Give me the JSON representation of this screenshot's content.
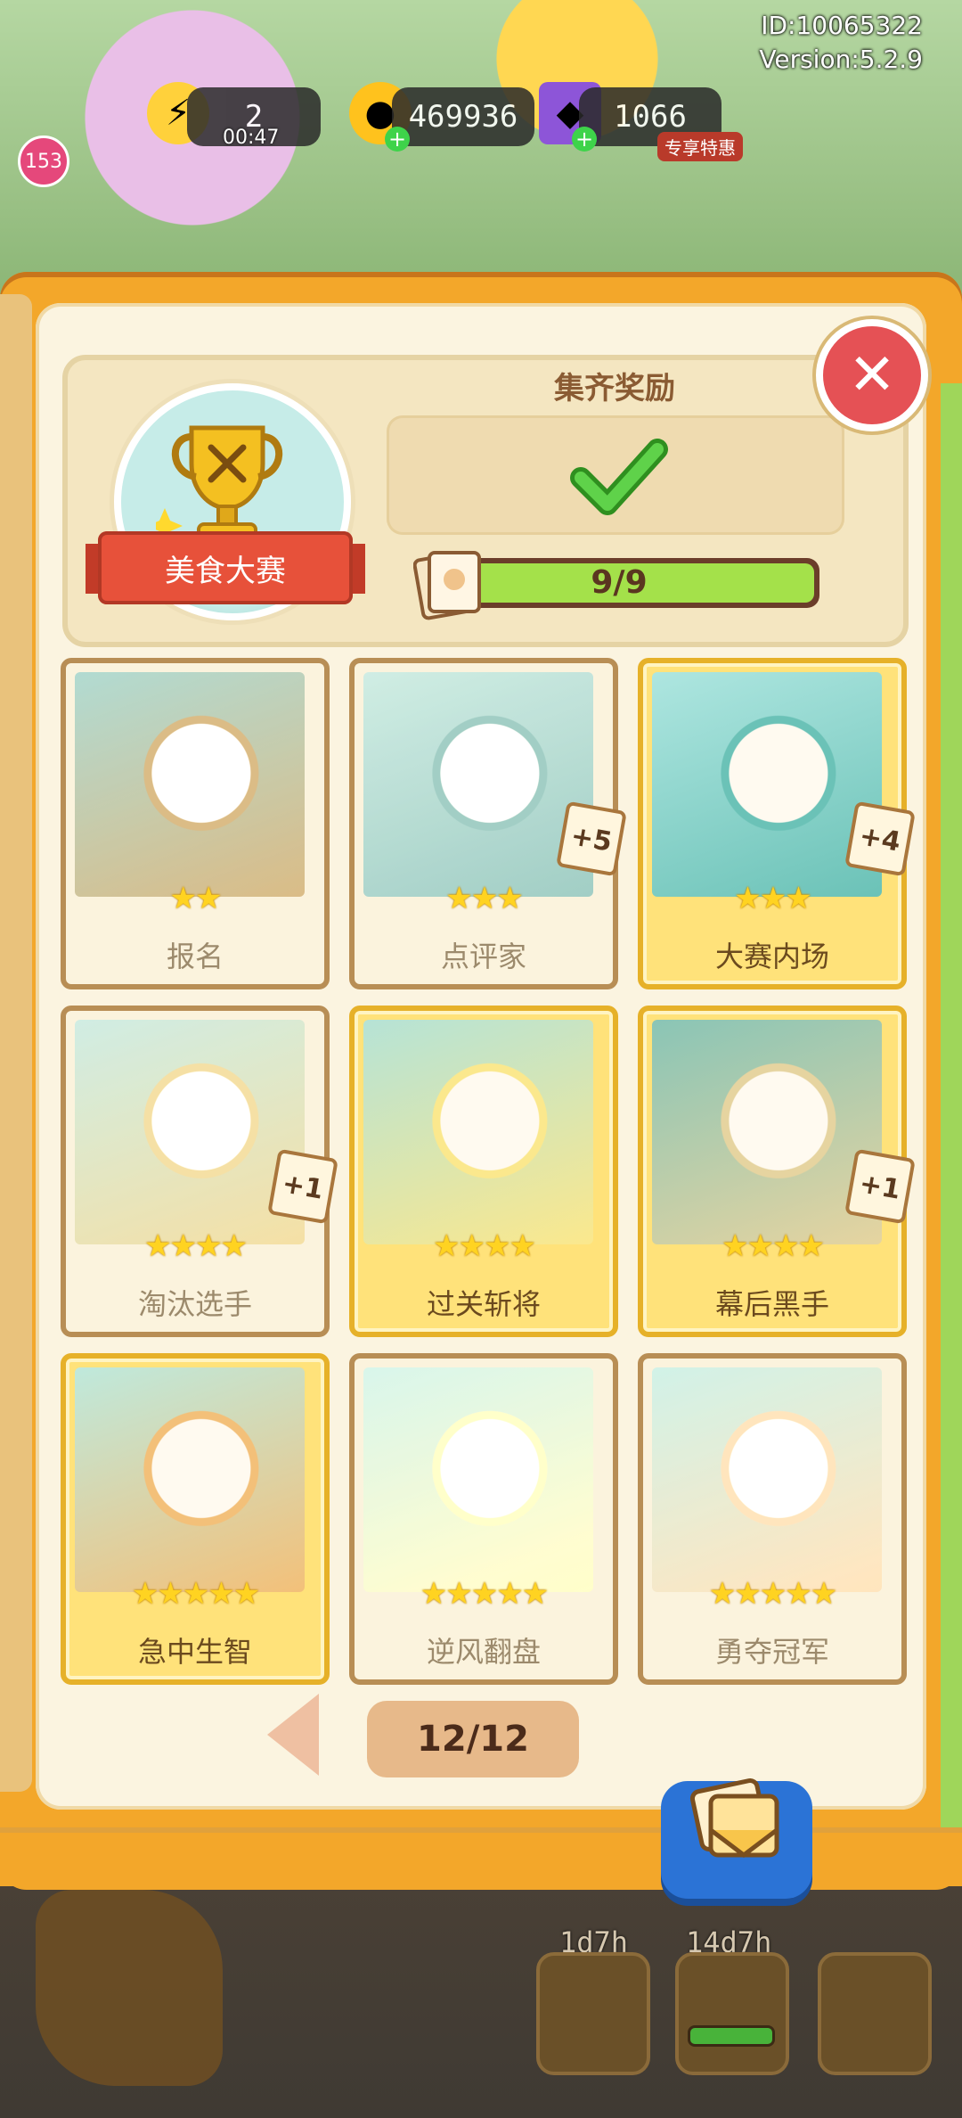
{
  "status": {
    "id_text": "ID:10065322",
    "version_text": "Version:5.2.9",
    "badge": "153"
  },
  "resources": {
    "energy": {
      "value": "2",
      "timer": "00:47"
    },
    "coins": {
      "value": "469936"
    },
    "gems": {
      "value": "1066",
      "tag": "专享特惠"
    }
  },
  "album": {
    "name": "美食大赛",
    "reward_title": "集齐奖励",
    "progress_text": "9/9",
    "progress_fraction": 1.0
  },
  "cards": [
    {
      "name": "报名",
      "stars": 2,
      "style": "plain",
      "extra": ""
    },
    {
      "name": "点评家",
      "stars": 3,
      "style": "plain",
      "extra": "+5"
    },
    {
      "name": "大赛内场",
      "stars": 3,
      "style": "gold",
      "extra": "+4"
    },
    {
      "name": "淘汰选手",
      "stars": 4,
      "style": "plain",
      "extra": "+1"
    },
    {
      "name": "过关斩将",
      "stars": 4,
      "style": "gold",
      "extra": ""
    },
    {
      "name": "幕后黑手",
      "stars": 4,
      "style": "gold",
      "extra": "+1"
    },
    {
      "name": "急中生智",
      "stars": 5,
      "style": "gold",
      "extra": ""
    },
    {
      "name": "逆风翻盘",
      "stars": 5,
      "style": "plain",
      "extra": ""
    },
    {
      "name": "勇夺冠军",
      "stars": 5,
      "style": "plain",
      "extra": ""
    }
  ],
  "pagination": {
    "page_text": "12/12"
  },
  "hud": {
    "timer_a": "1d7h",
    "timer_b": "14d7h"
  },
  "icons": {
    "close": "close-icon",
    "check": "check-icon",
    "trophy": "trophy-icon",
    "album": "album-icon"
  },
  "colors": {
    "accent_red": "#e55155",
    "progress_green": "#a4e14a",
    "book_orange": "#f3a72a",
    "star_gold": "#ffd321"
  }
}
